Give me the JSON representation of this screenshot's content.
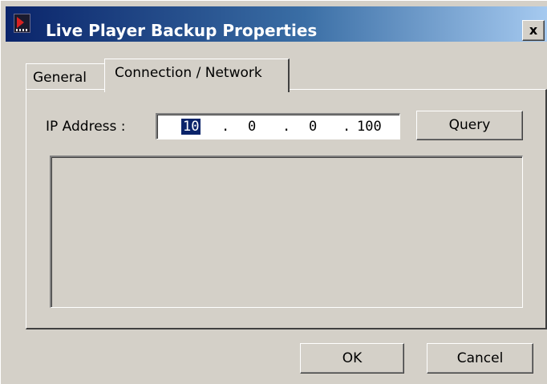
{
  "window": {
    "title": "Live Player Backup Properties",
    "icon": "live-player-app-icon",
    "close_glyph": "x"
  },
  "tabs": [
    {
      "label": "General",
      "active": false
    },
    {
      "label": "Connection / Network",
      "active": true
    }
  ],
  "connection": {
    "ip_label": "IP Address :",
    "ip_octets": [
      "10",
      "0",
      "0",
      "100"
    ],
    "ip_separator": ".",
    "query_label": "Query"
  },
  "footer": {
    "ok_label": "OK",
    "cancel_label": "Cancel"
  },
  "colors": {
    "title_bar_start": "#0a246a",
    "title_bar_end": "#a6caf0",
    "face": "#d4d0c8",
    "selection": "#0a246a"
  }
}
